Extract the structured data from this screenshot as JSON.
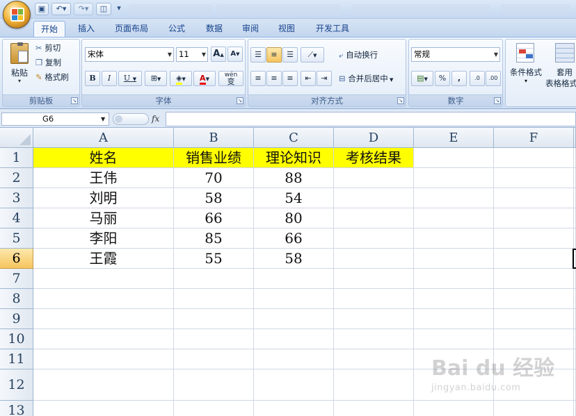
{
  "ribbon_tabs": [
    "开始",
    "插入",
    "页面布局",
    "公式",
    "数据",
    "审阅",
    "视图",
    "开发工具"
  ],
  "clipboard": {
    "paste": "粘贴",
    "cut": "剪切",
    "copy": "复制",
    "format_painter": "格式刷",
    "group": "剪贴板"
  },
  "font": {
    "name": "宋体",
    "size": "11",
    "bold": "B",
    "italic": "I",
    "underline": "U",
    "grow": "A",
    "shrink": "A",
    "font_color_glyph": "A",
    "phonetic": "wén",
    "phonetic_glyph": "变",
    "group": "字体"
  },
  "alignment": {
    "wrap_text": "自动换行",
    "merge_center": "合并后居中",
    "group": "对齐方式"
  },
  "number": {
    "format": "常规",
    "percent": "%",
    "comma": ",",
    "inc_decimal": ".0",
    "dec_decimal": ".00",
    "group": "数字"
  },
  "styles": {
    "conditional_format": "条件格式",
    "table_format_line1": "套用",
    "table_format_line2": "表格格式"
  },
  "formula_bar": {
    "name_box": "G6",
    "fx": "fx",
    "formula": ""
  },
  "columns": [
    "A",
    "B",
    "C",
    "D",
    "E",
    "F"
  ],
  "rows": [
    "1",
    "2",
    "3",
    "4",
    "5",
    "6",
    "7",
    "8",
    "9",
    "10",
    "11",
    "12",
    "13"
  ],
  "selected_row": "6",
  "table": {
    "headers": [
      "姓名",
      "销售业绩",
      "理论知识",
      "考核结果"
    ],
    "records": [
      {
        "name": "王伟",
        "sales": "70",
        "theory": "88"
      },
      {
        "name": "刘明",
        "sales": "58",
        "theory": "54"
      },
      {
        "name": "马丽",
        "sales": "66",
        "theory": "80"
      },
      {
        "name": "李阳",
        "sales": "85",
        "theory": "66"
      },
      {
        "name": "王霞",
        "sales": "55",
        "theory": "58"
      }
    ]
  },
  "colors": {
    "header_fill": "#ffff00",
    "ribbon_blue": "#15428b",
    "selected_row_header": "#f6c55f"
  },
  "watermark": {
    "brand": "Bai du 经验",
    "url": "jingyan.baidu.com"
  }
}
